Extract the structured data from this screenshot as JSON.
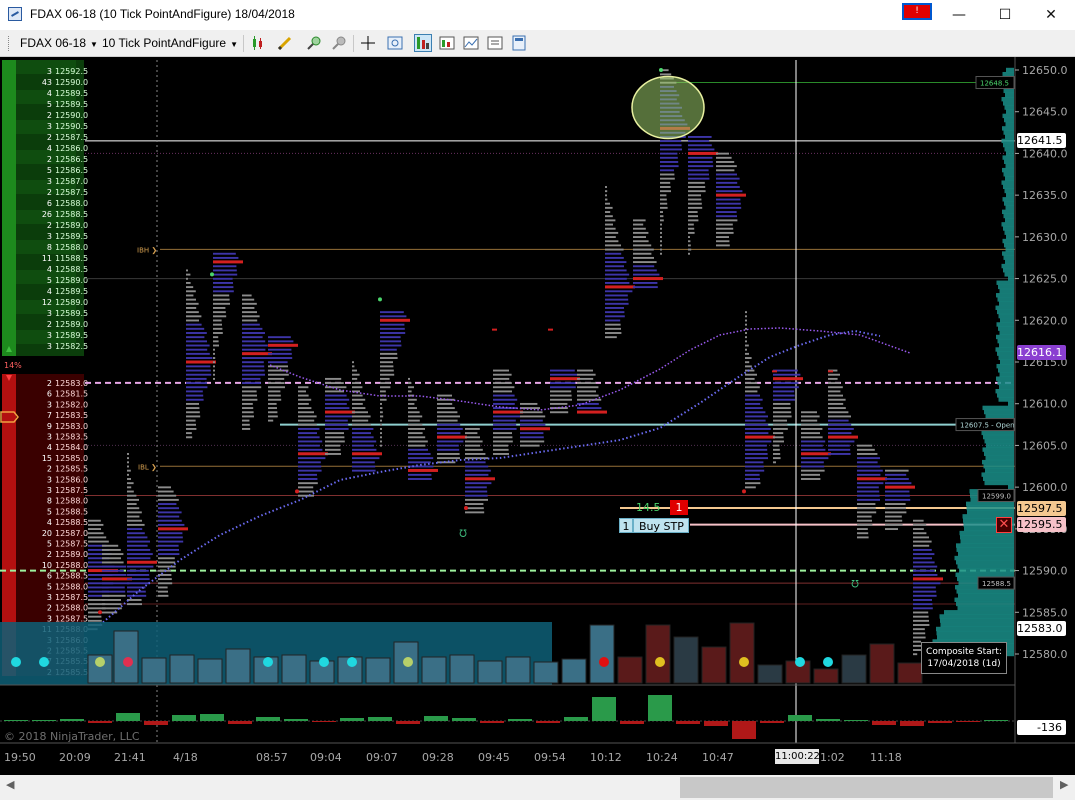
{
  "window": {
    "title": "FDAX 06-18 (10 Tick PointAndFigure)  18/04/2018",
    "alert_glyph": "!",
    "minimize": "—",
    "maximize": "☐",
    "close": "✕"
  },
  "toolbar": {
    "instrument": "FDAX 06-18",
    "bar_type": "10 Tick PointAndFigure",
    "arrow": "▼",
    "icons": [
      "candlestick-icon",
      "pencil-icon",
      "zoom-in-icon",
      "pin-icon",
      "crosshair-icon",
      "magnifier-icon",
      "chart-trader-icon",
      "data-box-icon",
      "strategy-icon",
      "properties-icon"
    ]
  },
  "price_axis": {
    "ticks": [
      "12650.0",
      "12645.0",
      "12640.0",
      "12635.0",
      "12630.0",
      "12625.0",
      "12620.0",
      "12615.0",
      "12610.0",
      "12605.0",
      "12600.0",
      "12595.0",
      "12590.0",
      "12585.0",
      "12580.0"
    ],
    "badges": [
      {
        "label": "12641.5",
        "color": "#ffffff",
        "text": "#000000"
      },
      {
        "label": "12616.1",
        "color": "#8a3fd1",
        "text": "#ffffff"
      },
      {
        "label": "12597.5",
        "color": "#f4c890",
        "text": "#000000"
      },
      {
        "label": "12595.5",
        "color": "#f6c1c8",
        "text": "#000000"
      },
      {
        "label": "12583.0",
        "color": "#ffffff",
        "text": "#000000"
      },
      {
        "label": "-136",
        "color": "#ffffff",
        "text": "#000000"
      }
    ],
    "line_labels": [
      {
        "text": "12648.5",
        "color": "#4bd66c"
      },
      {
        "text": "12607.5 - Open",
        "color": "#b0d8d8"
      },
      {
        "text": "12599.0",
        "color": "#c0c0c0"
      },
      {
        "text": "12588.5",
        "color": "#c0c0c0"
      }
    ]
  },
  "time_axis": {
    "labels": [
      "19:50",
      "20:09",
      "21:41",
      "4/18",
      "08:57",
      "09:04",
      "09:07",
      "09:28",
      "09:45",
      "09:54",
      "10:12",
      "10:24",
      "10:47",
      "11:00:22",
      "1:02",
      "11:18"
    ],
    "crosshair_time": "11:00:22"
  },
  "ladder": {
    "bid_rows": [
      {
        "count": "3",
        "price": "12592.5"
      },
      {
        "count": "43",
        "price": "12590.0"
      },
      {
        "count": "4",
        "price": "12589.5"
      },
      {
        "count": "5",
        "price": "12589.5"
      },
      {
        "count": "2",
        "price": "12590.0"
      },
      {
        "count": "3",
        "price": "12590.5"
      },
      {
        "count": "2",
        "price": "12587.5"
      },
      {
        "count": "4",
        "price": "12586.0"
      },
      {
        "count": "2",
        "price": "12586.5"
      },
      {
        "count": "5",
        "price": "12586.5"
      },
      {
        "count": "3",
        "price": "12587.0"
      },
      {
        "count": "2",
        "price": "12587.5"
      },
      {
        "count": "6",
        "price": "12588.0"
      },
      {
        "count": "26",
        "price": "12588.5"
      },
      {
        "count": "2",
        "price": "12589.0"
      },
      {
        "count": "3",
        "price": "12589.5"
      },
      {
        "count": "8",
        "price": "12588.0"
      },
      {
        "count": "11",
        "price": "11588.5"
      },
      {
        "count": "4",
        "price": "12588.5"
      },
      {
        "count": "5",
        "price": "12589.0"
      },
      {
        "count": "4",
        "price": "12589.5"
      },
      {
        "count": "12",
        "price": "12589.0"
      },
      {
        "count": "3",
        "price": "12589.5"
      },
      {
        "count": "2",
        "price": "12589.0"
      },
      {
        "count": "3",
        "price": "12589.5"
      },
      {
        "count": "3",
        "price": "12582.5"
      }
    ],
    "ask_rows": [
      {
        "count": "2",
        "price": "12583.0"
      },
      {
        "count": "6",
        "price": "12581.5"
      },
      {
        "count": "3",
        "price": "12582.0"
      },
      {
        "count": "7",
        "price": "12583.5"
      },
      {
        "count": "9",
        "price": "12583.0"
      },
      {
        "count": "3",
        "price": "12583.5"
      },
      {
        "count": "4",
        "price": "12584.0"
      },
      {
        "count": "15",
        "price": "12585.0"
      },
      {
        "count": "2",
        "price": "12585.5"
      },
      {
        "count": "3",
        "price": "12586.0"
      },
      {
        "count": "3",
        "price": "12587.5"
      },
      {
        "count": "8",
        "price": "12588.0"
      },
      {
        "count": "5",
        "price": "12588.5"
      },
      {
        "count": "4",
        "price": "12588.5"
      },
      {
        "count": "20",
        "price": "12587.0"
      },
      {
        "count": "5",
        "price": "12587.5"
      },
      {
        "count": "2",
        "price": "12589.0"
      },
      {
        "count": "10",
        "price": "12588.0"
      },
      {
        "count": "6",
        "price": "12588.5"
      },
      {
        "count": "5",
        "price": "12588.0"
      },
      {
        "count": "3",
        "price": "12587.5"
      },
      {
        "count": "2",
        "price": "12588.0"
      },
      {
        "count": "3",
        "price": "12587.5"
      },
      {
        "count": "11",
        "price": "12588.0"
      },
      {
        "count": "3",
        "price": "12586.0"
      },
      {
        "count": "2",
        "price": "12585.5"
      },
      {
        "count": "7",
        "price": "12585.5"
      },
      {
        "count": "2",
        "price": "12585.5"
      }
    ],
    "bid_pct": "14%"
  },
  "markers": {
    "ibh": "IBH",
    "ibl": "IBL"
  },
  "order": {
    "pnl": "14.5",
    "flag": "1",
    "qty": "1",
    "label": "Buy STP"
  },
  "composite_box": {
    "line1": "Composite Start:",
    "line2": "17/04/2018 (1d)"
  },
  "copyright": "© 2018 NinjaTrader, LLC",
  "colors": {
    "background": "#000000",
    "green": "#2fbf4a",
    "red": "#d32020",
    "purple_poc": "#7b5cd6",
    "profile_blue": "#2f2fa0",
    "profile_grey": "#8c8c8c",
    "volume_cyan": "#1a8fa6"
  }
}
